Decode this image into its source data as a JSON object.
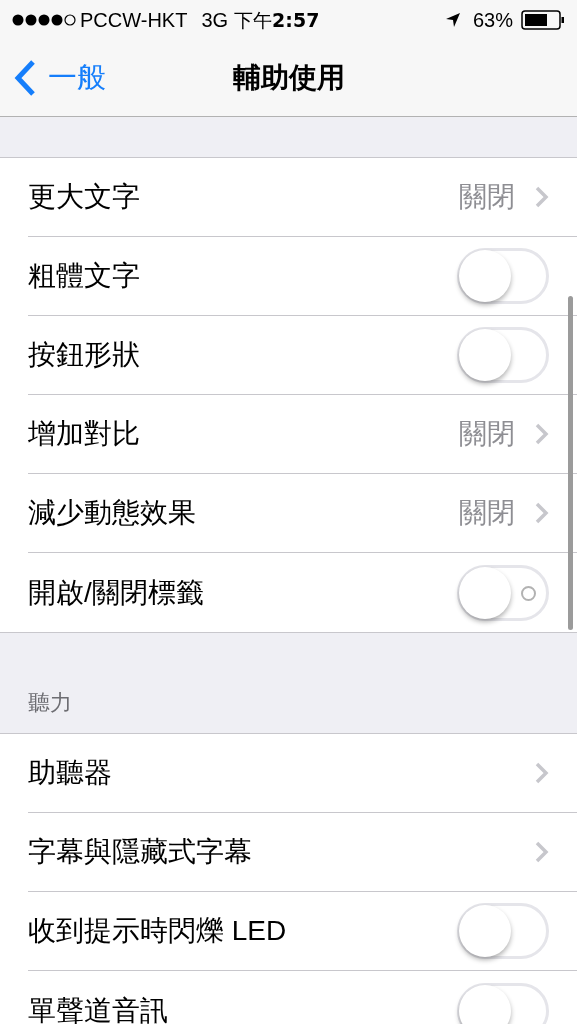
{
  "status_bar": {
    "carrier": "PCCW-HKT",
    "network": "3G",
    "time": "下午**2:57**",
    "battery": "63%"
  },
  "nav": {
    "back": "一般",
    "title": "輔助使用"
  },
  "sections": [
    {
      "rows": [
        {
          "kind": "value",
          "label": "更大文字",
          "value": "關閉"
        },
        {
          "kind": "toggle",
          "label": "粗體文字",
          "on": false
        },
        {
          "kind": "toggle",
          "label": "按鈕形狀",
          "on": false
        },
        {
          "kind": "value",
          "label": "增加對比",
          "value": "關閉"
        },
        {
          "kind": "value",
          "label": "減少動態效果",
          "value": "關閉"
        },
        {
          "kind": "toggle",
          "label": "開啟/關閉標籤",
          "on": false,
          "switch_labels": true
        }
      ]
    },
    {
      "header": "聽力",
      "rows": [
        {
          "kind": "link",
          "label": "助聽器"
        },
        {
          "kind": "link",
          "label": "字幕與隱藏式字幕"
        },
        {
          "kind": "toggle",
          "label": "收到提示時閃爍 LED",
          "on": false
        },
        {
          "kind": "toggle",
          "label": "單聲道音訊",
          "on": false
        }
      ]
    }
  ]
}
